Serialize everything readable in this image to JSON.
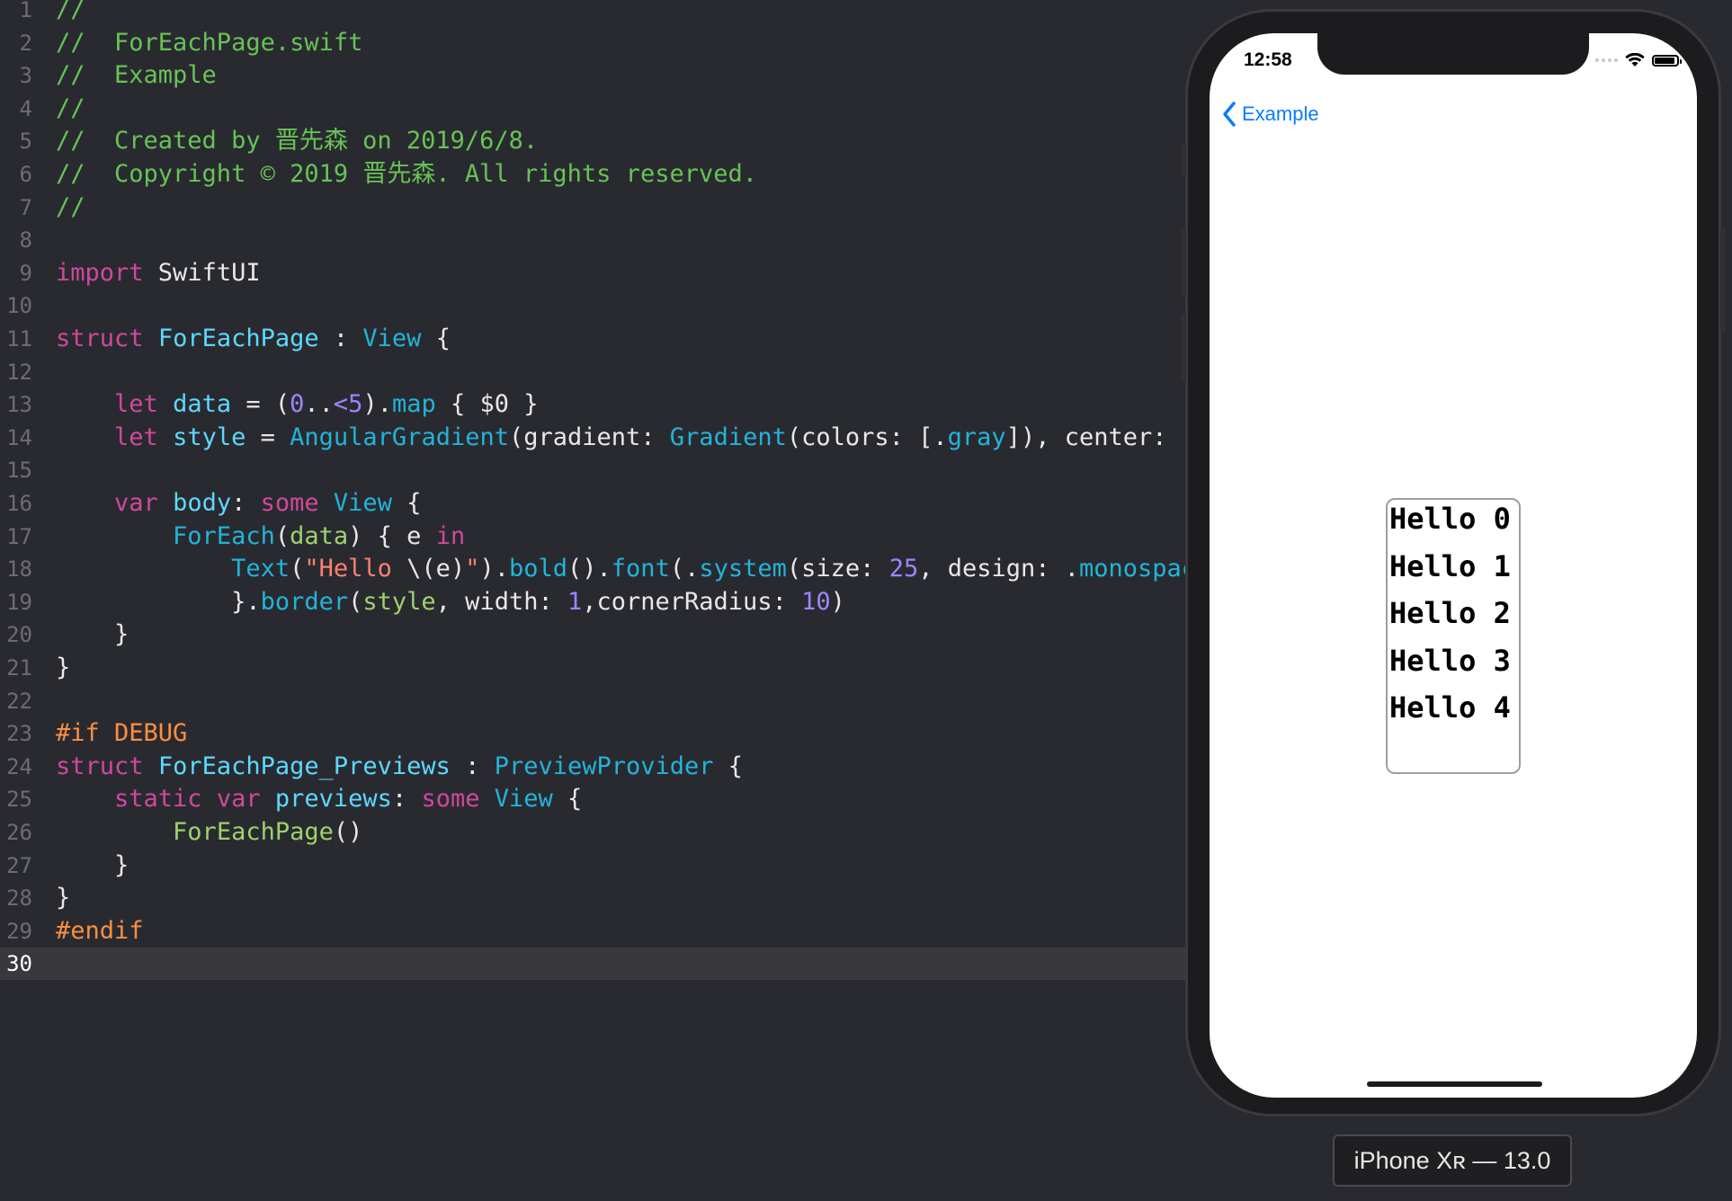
{
  "editor": {
    "current_line": 30,
    "lines": [
      {
        "n": "1",
        "tokens": [
          {
            "c": "comment",
            "t": "//"
          }
        ]
      },
      {
        "n": "2",
        "tokens": [
          {
            "c": "comment",
            "t": "//  ForEachPage.swift"
          }
        ]
      },
      {
        "n": "3",
        "tokens": [
          {
            "c": "comment",
            "t": "//  Example"
          }
        ]
      },
      {
        "n": "4",
        "tokens": [
          {
            "c": "comment",
            "t": "//"
          }
        ]
      },
      {
        "n": "5",
        "tokens": [
          {
            "c": "comment",
            "t": "//  Created by 晋先森 on 2019/6/8."
          }
        ]
      },
      {
        "n": "6",
        "tokens": [
          {
            "c": "comment",
            "t": "//  Copyright © 2019 晋先森. All rights reserved."
          }
        ]
      },
      {
        "n": "7",
        "tokens": [
          {
            "c": "comment",
            "t": "//"
          }
        ]
      },
      {
        "n": "8",
        "tokens": []
      },
      {
        "n": "9",
        "tokens": [
          {
            "c": "kw",
            "t": "import"
          },
          {
            "c": "plain",
            "t": " SwiftUI"
          }
        ]
      },
      {
        "n": "10",
        "tokens": []
      },
      {
        "n": "11",
        "tokens": [
          {
            "c": "kw",
            "t": "struct"
          },
          {
            "c": "plain",
            "t": " "
          },
          {
            "c": "type",
            "t": "ForEachPage"
          },
          {
            "c": "plain",
            "t": " : "
          },
          {
            "c": "cls",
            "t": "View"
          },
          {
            "c": "plain",
            "t": " {"
          }
        ]
      },
      {
        "n": "12",
        "tokens": []
      },
      {
        "n": "13",
        "tokens": [
          {
            "c": "plain",
            "t": "    "
          },
          {
            "c": "kw",
            "t": "let"
          },
          {
            "c": "plain",
            "t": " "
          },
          {
            "c": "type",
            "t": "data"
          },
          {
            "c": "plain",
            "t": " = ("
          },
          {
            "c": "num",
            "t": "0"
          },
          {
            "c": "plain",
            "t": ".."
          },
          {
            "c": "num",
            "t": "<5"
          },
          {
            "c": "plain",
            "t": ")."
          },
          {
            "c": "cls",
            "t": "map"
          },
          {
            "c": "plain",
            "t": " { $0 }"
          }
        ]
      },
      {
        "n": "14",
        "tokens": [
          {
            "c": "plain",
            "t": "    "
          },
          {
            "c": "kw",
            "t": "let"
          },
          {
            "c": "plain",
            "t": " "
          },
          {
            "c": "type",
            "t": "style"
          },
          {
            "c": "plain",
            "t": " = "
          },
          {
            "c": "cls",
            "t": "AngularGradient"
          },
          {
            "c": "plain",
            "t": "(gradient: "
          },
          {
            "c": "cls",
            "t": "Gradient"
          },
          {
            "c": "plain",
            "t": "(colors: [."
          },
          {
            "c": "cls",
            "t": "gray"
          },
          {
            "c": "plain",
            "t": "]), center: ."
          }
        ]
      },
      {
        "n": "15",
        "tokens": []
      },
      {
        "n": "16",
        "tokens": [
          {
            "c": "plain",
            "t": "    "
          },
          {
            "c": "kw",
            "t": "var"
          },
          {
            "c": "plain",
            "t": " "
          },
          {
            "c": "type",
            "t": "body"
          },
          {
            "c": "plain",
            "t": ": "
          },
          {
            "c": "kw",
            "t": "some"
          },
          {
            "c": "plain",
            "t": " "
          },
          {
            "c": "cls",
            "t": "View"
          },
          {
            "c": "plain",
            "t": " {"
          }
        ]
      },
      {
        "n": "17",
        "tokens": [
          {
            "c": "plain",
            "t": "        "
          },
          {
            "c": "cls",
            "t": "ForEach"
          },
          {
            "c": "plain",
            "t": "("
          },
          {
            "c": "fn",
            "t": "data"
          },
          {
            "c": "plain",
            "t": ") { e "
          },
          {
            "c": "kw",
            "t": "in"
          }
        ]
      },
      {
        "n": "18",
        "tokens": [
          {
            "c": "plain",
            "t": "            "
          },
          {
            "c": "cls",
            "t": "Text"
          },
          {
            "c": "plain",
            "t": "("
          },
          {
            "c": "str",
            "t": "\"Hello "
          },
          {
            "c": "plain",
            "t": "\\(e)"
          },
          {
            "c": "str",
            "t": "\""
          },
          {
            "c": "plain",
            "t": ")."
          },
          {
            "c": "cls",
            "t": "bold"
          },
          {
            "c": "plain",
            "t": "()."
          },
          {
            "c": "cls",
            "t": "font"
          },
          {
            "c": "plain",
            "t": "(."
          },
          {
            "c": "cls",
            "t": "system"
          },
          {
            "c": "plain",
            "t": "(size: "
          },
          {
            "c": "num",
            "t": "25"
          },
          {
            "c": "plain",
            "t": ", design: ."
          },
          {
            "c": "cls",
            "t": "monospac"
          }
        ]
      },
      {
        "n": "19",
        "tokens": [
          {
            "c": "plain",
            "t": "            }."
          },
          {
            "c": "cls",
            "t": "border"
          },
          {
            "c": "plain",
            "t": "("
          },
          {
            "c": "fn",
            "t": "style"
          },
          {
            "c": "plain",
            "t": ", width: "
          },
          {
            "c": "num",
            "t": "1"
          },
          {
            "c": "plain",
            "t": ",cornerRadius: "
          },
          {
            "c": "num",
            "t": "10"
          },
          {
            "c": "plain",
            "t": ")"
          }
        ]
      },
      {
        "n": "20",
        "tokens": [
          {
            "c": "plain",
            "t": "    }"
          }
        ]
      },
      {
        "n": "21",
        "tokens": [
          {
            "c": "plain",
            "t": "}"
          }
        ]
      },
      {
        "n": "22",
        "tokens": []
      },
      {
        "n": "23",
        "tokens": [
          {
            "c": "pre",
            "t": "#if DEBUG"
          }
        ]
      },
      {
        "n": "24",
        "tokens": [
          {
            "c": "kw",
            "t": "struct"
          },
          {
            "c": "plain",
            "t": " "
          },
          {
            "c": "type",
            "t": "ForEachPage_Previews"
          },
          {
            "c": "plain",
            "t": " : "
          },
          {
            "c": "cls",
            "t": "PreviewProvider"
          },
          {
            "c": "plain",
            "t": " {"
          }
        ]
      },
      {
        "n": "25",
        "tokens": [
          {
            "c": "plain",
            "t": "    "
          },
          {
            "c": "kw",
            "t": "static"
          },
          {
            "c": "plain",
            "t": " "
          },
          {
            "c": "kw",
            "t": "var"
          },
          {
            "c": "plain",
            "t": " "
          },
          {
            "c": "type",
            "t": "previews"
          },
          {
            "c": "plain",
            "t": ": "
          },
          {
            "c": "kw",
            "t": "some"
          },
          {
            "c": "plain",
            "t": " "
          },
          {
            "c": "cls",
            "t": "View"
          },
          {
            "c": "plain",
            "t": " {"
          }
        ]
      },
      {
        "n": "26",
        "tokens": [
          {
            "c": "plain",
            "t": "        "
          },
          {
            "c": "fn",
            "t": "ForEachPage"
          },
          {
            "c": "plain",
            "t": "()"
          }
        ]
      },
      {
        "n": "27",
        "tokens": [
          {
            "c": "plain",
            "t": "    }"
          }
        ]
      },
      {
        "n": "28",
        "tokens": [
          {
            "c": "plain",
            "t": "}"
          }
        ]
      },
      {
        "n": "29",
        "tokens": [
          {
            "c": "pre",
            "t": "#endif"
          }
        ]
      },
      {
        "n": "30",
        "tokens": []
      }
    ]
  },
  "preview": {
    "status_time": "12:58",
    "back_label": "Example",
    "hello_items": [
      "Hello 0",
      "Hello 1",
      "Hello 2",
      "Hello 3",
      "Hello 4"
    ],
    "device_label": "iPhone Xʀ — 13.0",
    "accent_color": "#0a7bff"
  }
}
